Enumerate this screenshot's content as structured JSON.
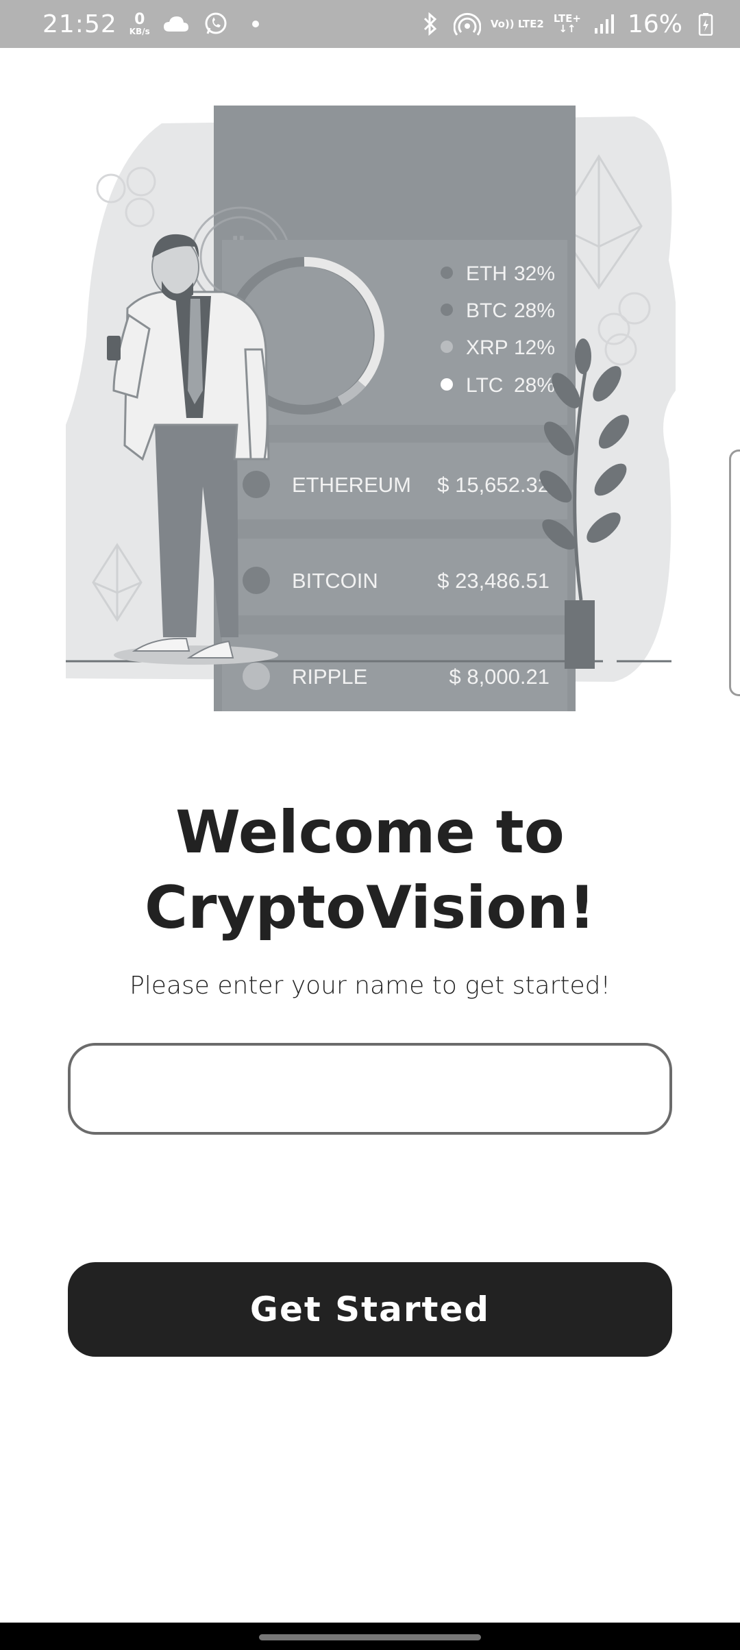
{
  "status_bar": {
    "time": "21:52",
    "net_speed_value": "0",
    "net_speed_unit": "KB/s",
    "volte_label": "Vo)) LTE2",
    "lte_label": "LTE+",
    "battery": "16%",
    "icons": [
      "cloud-icon",
      "whatsapp-icon",
      "dot-icon",
      "bluetooth-icon",
      "hotspot-icon",
      "signal-icon",
      "battery-icon"
    ]
  },
  "illustration": {
    "legend": [
      {
        "symbol": "ETH",
        "percent": "32%"
      },
      {
        "symbol": "BTC",
        "percent": "28%"
      },
      {
        "symbol": "XRP",
        "percent": "12%"
      },
      {
        "symbol": "LTC",
        "percent": "28%"
      }
    ],
    "coins": [
      {
        "name": "ETHEREUM",
        "price": "$ 15,652.32"
      },
      {
        "name": "BITCOIN",
        "price": "$ 23,486.51"
      },
      {
        "name": "RIPPLE",
        "price": "$ 8,000.21"
      }
    ]
  },
  "welcome": {
    "title_line1": "Welcome to",
    "title_line2": "CryptoVision!",
    "subtitle": "Please enter your name to get started!"
  },
  "name_input": {
    "value": "",
    "placeholder": ""
  },
  "get_started_label": "Get Started",
  "colors": {
    "primary_dark": "#222222",
    "status_bar_bg": "#b3b3b3",
    "illustration_gray": "#8f9498"
  }
}
